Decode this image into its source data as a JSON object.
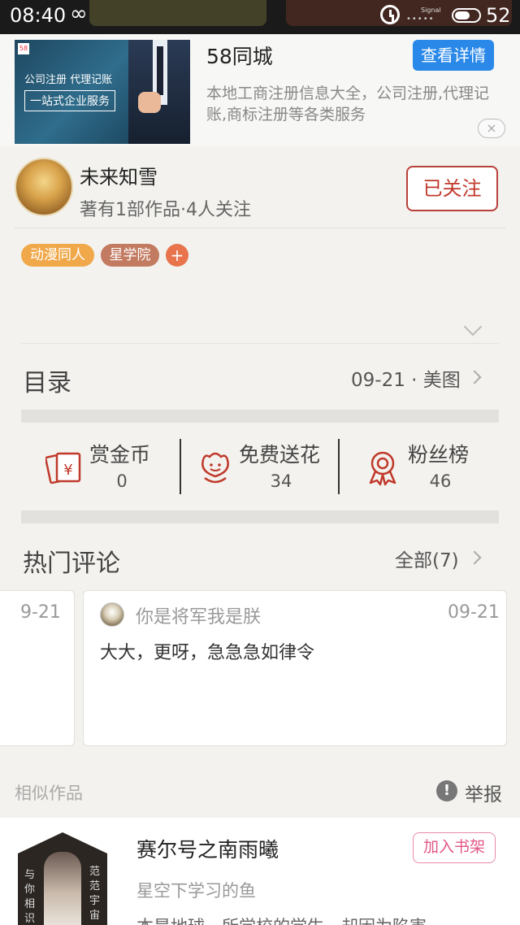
{
  "status_bar": {
    "time": "08:40",
    "signal_label": "Signal",
    "battery": "52"
  },
  "ad": {
    "image_line1": "公司注册 代理记账",
    "image_line2": "一站式企业服务",
    "image_badge": "58",
    "title": "58同城",
    "button": "查看详情",
    "description": "本地工商注册信息大全，公司注册,代理记账,商标注册等各类服务",
    "close": "×"
  },
  "author": {
    "name": "未来知雪",
    "meta": "著有1部作品·4人关注",
    "follow_button": "已关注"
  },
  "tags": [
    "动漫同人",
    "星学院",
    "+"
  ],
  "catalog": {
    "title": "目录",
    "info": "09-21 · 美图"
  },
  "stats": [
    {
      "label": "赏金币",
      "value": "0",
      "icon": "red-envelope-icon"
    },
    {
      "label": "免费送花",
      "value": "34",
      "icon": "flower-icon"
    },
    {
      "label": "粉丝榜",
      "value": "46",
      "icon": "medal-icon"
    }
  ],
  "comments": {
    "title": "热门评论",
    "all": "全部(7)",
    "partial_date": "9-21",
    "items": [
      {
        "user": "你是将军我是朕",
        "date": "09-21",
        "text": "大大，更呀，急急急如律令"
      }
    ]
  },
  "similar": {
    "label": "相似作品",
    "report": "举报",
    "book": {
      "title": "赛尔号之南雨曦",
      "author": "星空下学习的鱼",
      "description": "本是地球一所学校的学生，却因为陷害",
      "add_button": "加入书架",
      "cover_left": "与你相识",
      "cover_right": "范范宇宙"
    }
  },
  "colors": {
    "accent_red": "#c0392b",
    "ad_button_blue": "#2a88e8",
    "tag_orange": "#f0a84a",
    "tag_brown": "#c27a61",
    "pink": "#e25786"
  }
}
